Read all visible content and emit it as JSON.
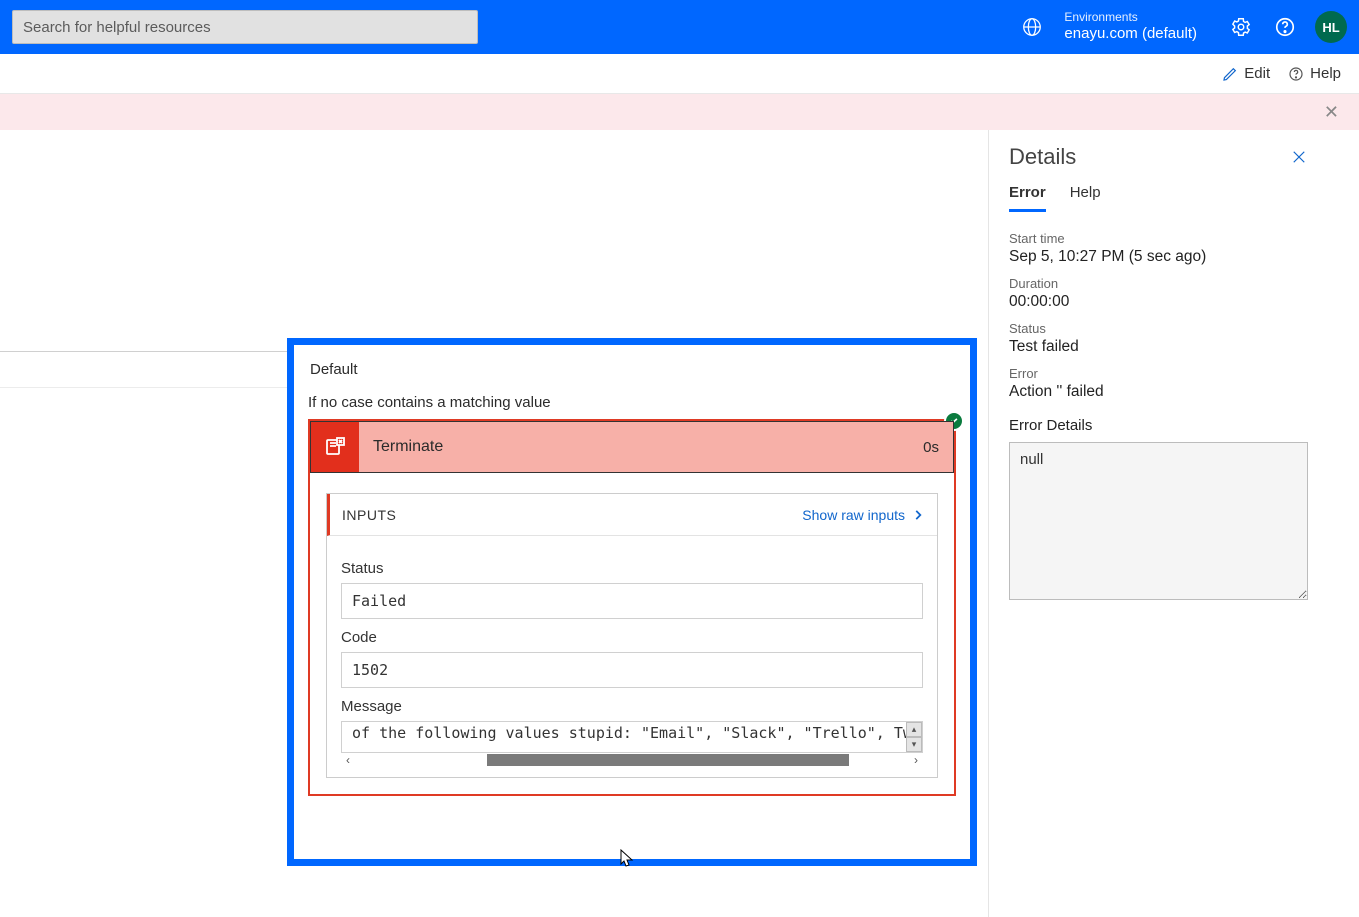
{
  "topbar": {
    "search_placeholder": "Search for helpful resources",
    "env_label": "Environments",
    "env_value": "enayu.com (default)",
    "avatar_initials": "HL"
  },
  "commands": {
    "edit": "Edit",
    "help": "Help"
  },
  "designer": {
    "default_label": "Default",
    "no_case_text": "If no case contains a matching value",
    "action": {
      "name": "Terminate",
      "duration": "0s",
      "inputs_heading": "INPUTS",
      "raw_link": "Show raw inputs",
      "fields": {
        "status_label": "Status",
        "status_value": "Failed",
        "code_label": "Code",
        "code_value": "1502",
        "message_label": "Message",
        "message_value": "of the following values stupid: \"Email\", \"Slack\", \"Trello\", Tweet"
      }
    }
  },
  "details": {
    "title": "Details",
    "tabs": {
      "error": "Error",
      "help": "Help"
    },
    "start_time_label": "Start time",
    "start_time_value": "Sep 5, 10:27 PM (5 sec ago)",
    "duration_label": "Duration",
    "duration_value": "00:00:00",
    "status_label": "Status",
    "status_value": "Test failed",
    "error_label": "Error",
    "error_value": "Action '' failed",
    "error_details_label": "Error Details",
    "error_details_value": "null"
  }
}
